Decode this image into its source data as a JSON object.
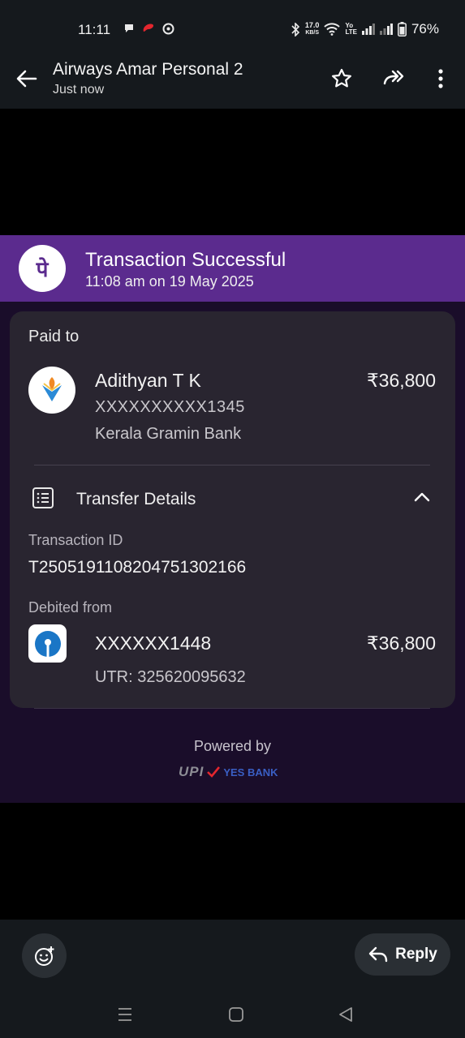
{
  "status_bar": {
    "time": "11:11",
    "net_speed": "17.0",
    "net_unit": "KB/S",
    "volte_top": "Yo",
    "volte_bottom": "LTE",
    "battery": "76%"
  },
  "header": {
    "title": "Airways Amar Personal 2",
    "subtitle": "Just now"
  },
  "receipt": {
    "status_title": "Transaction Successful",
    "timestamp": "11:08 am on 19 May 2025",
    "paid_to_label": "Paid to",
    "payee_name": "Adithyan T K",
    "payee_account": "XXXXXXXXXX1345",
    "payee_bank": "Kerala Gramin Bank",
    "amount": "₹36,800",
    "transfer_details_label": "Transfer Details",
    "transaction_id_label": "Transaction ID",
    "transaction_id": "T2505191108204751302166",
    "debited_from_label": "Debited from",
    "debit_account": "XXXXXX1448",
    "debit_amount": "₹36,800",
    "utr": "UTR: 325620095632",
    "powered_by": "Powered by",
    "upi_text": "UPI",
    "yes_bank_text": "YES BANK",
    "brand_glyph": "पे"
  },
  "bottom_bar": {
    "reply_label": "Reply"
  },
  "colors": {
    "phonepe_purple": "#5b2b8e",
    "receipt_bg": "#1a0d2a",
    "card_bg": "#292530",
    "app_bar": "#15191d"
  }
}
